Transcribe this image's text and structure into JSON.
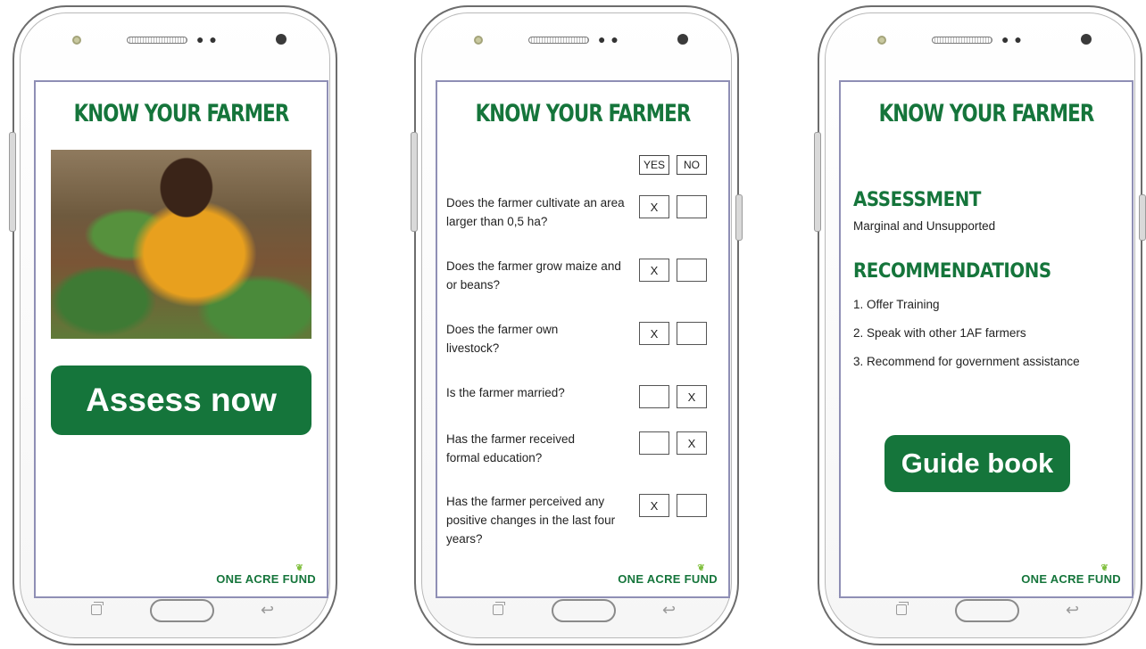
{
  "screen1": {
    "title": "KNOW YOUR FARMER",
    "assess_button": "Assess now",
    "logo": "ONE ACRE FUND"
  },
  "screen2": {
    "title": "KNOW YOUR FARMER",
    "yes_label": "YES",
    "no_label": "NO",
    "questions": [
      {
        "text": "Does the farmer cultivate an area larger than 0,5 ha?",
        "yes": "X",
        "no": ""
      },
      {
        "text": "Does the farmer grow maize and or beans?",
        "yes": "X",
        "no": ""
      },
      {
        "text": "Does the farmer own livestock?",
        "yes": "X",
        "no": ""
      },
      {
        "text": "Is the farmer married?",
        "yes": "",
        "no": "X"
      },
      {
        "text": "Has the farmer received formal education?",
        "yes": "",
        "no": "X"
      },
      {
        "text": "Has the farmer perceived any positive changes in the last four years?",
        "yes": "X",
        "no": ""
      }
    ],
    "logo": "ONE ACRE FUND"
  },
  "screen3": {
    "title": "KNOW YOUR FARMER",
    "assessment_heading": "ASSESSMENT",
    "assessment_value": "Marginal and Unsupported",
    "recommendations_heading": "RECOMMENDATIONS",
    "recommendations": [
      "1.  Offer Training",
      "2.  Speak with other 1AF farmers",
      "3.  Recommend for government assistance"
    ],
    "guide_button": "Guide book",
    "logo": "ONE ACRE FUND"
  },
  "colors": {
    "brand_green": "#15753b",
    "screen_border": "#8f8fb5"
  }
}
